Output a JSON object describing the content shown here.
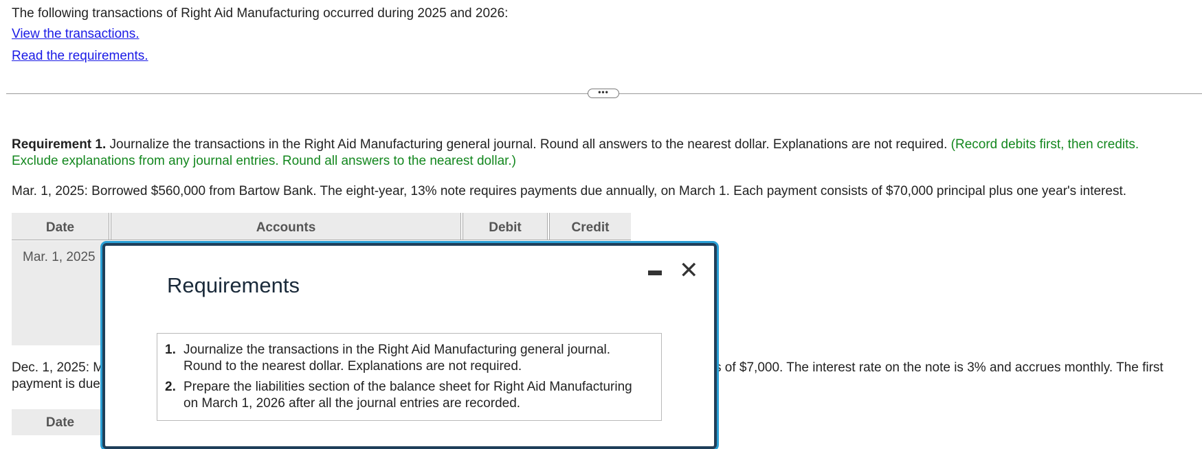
{
  "intro": {
    "text": "The following transactions of Right Aid Manufacturing occurred during 2025 and 2026:",
    "link_view": "View the transactions.",
    "link_read": "Read the requirements."
  },
  "divider": {
    "dots": "•••"
  },
  "requirement1": {
    "label": "Requirement 1.",
    "text": "Journalize the transactions in the Right Aid Manufacturing general journal. Round all answers to the nearest dollar. Explanations are not required.",
    "note_line1": "(Record debits first, then credits.",
    "note_line2": "Exclude explanations from any journal entries. Round all answers to the nearest dollar.)"
  },
  "transaction1": {
    "text": "Mar. 1, 2025: Borrowed $560,000 from Bartow Bank. The eight-year, 13% note requires payments due annually, on March 1. Each payment consists of $70,000 principal plus one year's interest."
  },
  "journal_table": {
    "headers": {
      "date": "Date",
      "accounts": "Accounts",
      "debit": "Debit",
      "credit": "Credit"
    },
    "first_date": "Mar. 1, 2025"
  },
  "transaction2": {
    "visible_left_line1": "Dec. 1, 2025: M",
    "visible_left_line2": "payment is due",
    "visible_right": "s of $7,000. The interest rate on the note is 3% and accrues monthly. The first"
  },
  "journal_table_2": {
    "date_header": "Date"
  },
  "modal": {
    "title": "Requirements",
    "minimize_label": "",
    "close_label": "✕",
    "items": [
      {
        "num": "1.",
        "line1": "Journalize the transactions in the Right Aid Manufacturing general journal.",
        "line2": "Round to the nearest dollar. Explanations are not required."
      },
      {
        "num": "2.",
        "line1": "Prepare the liabilities section of the balance sheet for Right Aid Manufacturing",
        "line2": "on March 1, 2026 after all the journal entries are recorded."
      }
    ]
  }
}
